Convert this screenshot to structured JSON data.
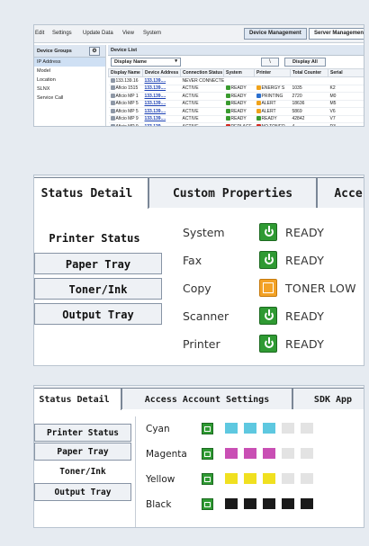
{
  "panel1": {
    "menu": [
      "Edit",
      "Settings",
      "Update Data",
      "View",
      "System"
    ],
    "toolbar_tabs": [
      "Device Management",
      "Server Management"
    ],
    "groups": {
      "title": "Device Groups",
      "items": [
        "IP Address",
        "Model",
        "Location",
        "SLNX",
        "Service Call"
      ]
    },
    "device_list": {
      "title": "Device List",
      "display_select": "Display Name",
      "search_button": "\\",
      "display_all": "Display All",
      "columns": [
        "Display Name",
        "Device Address",
        "Connection Status",
        "System",
        "Printer",
        "Total Counter",
        "Serial"
      ],
      "rows": [
        {
          "name": "133.139.16",
          "addr": "133.139....",
          "conn": "NEVER CONNECTED",
          "sys": "",
          "sys_icon": "",
          "printer": "",
          "printer_icon": "",
          "counter": "",
          "serial": ""
        },
        {
          "name": "Aficio 1515",
          "addr": "133.139....",
          "conn": "ACTIVE",
          "sys": "READY",
          "sys_icon": "g",
          "printer": "ENERGY S",
          "printer_icon": "y",
          "counter": "1035",
          "serial": "K2"
        },
        {
          "name": "Aficio MP 1",
          "addr": "133.139....",
          "conn": "ACTIVE",
          "sys": "READY",
          "sys_icon": "g",
          "printer": "PRINTING",
          "printer_icon": "b",
          "counter": "2720",
          "serial": "M0"
        },
        {
          "name": "Aficio MP 5",
          "addr": "133.139....",
          "conn": "ACTIVE",
          "sys": "READY",
          "sys_icon": "g",
          "printer": "ALERT",
          "printer_icon": "y",
          "counter": "18636",
          "serial": "M5"
        },
        {
          "name": "Aficio MP 5",
          "addr": "133.139....",
          "conn": "ACTIVE",
          "sys": "READY",
          "sys_icon": "g",
          "printer": "ALERT",
          "printer_icon": "y",
          "counter": "5869",
          "serial": "V6"
        },
        {
          "name": "Aficio MP 9",
          "addr": "133.139....",
          "conn": "ACTIVE",
          "sys": "READY",
          "sys_icon": "g",
          "printer": "READY",
          "printer_icon": "g",
          "counter": "42842",
          "serial": "V7"
        },
        {
          "name": "Aficio MP 9",
          "addr": "133.139....",
          "conn": "ACTIVE",
          "sys": "REPLACE",
          "sys_icon": "r",
          "printer": "NO TONER",
          "printer_icon": "r",
          "counter": "4",
          "serial": "D3"
        }
      ]
    }
  },
  "panel2": {
    "tabs": [
      "Status Detail",
      "Custom Properties",
      "Acce"
    ],
    "side": [
      "Printer Status",
      "Paper Tray",
      "Toner/Ink",
      "Output Tray"
    ],
    "rows": [
      {
        "label": "System",
        "value": "READY",
        "icon": "ready-icon"
      },
      {
        "label": "Fax",
        "value": "READY",
        "icon": "ready-icon"
      },
      {
        "label": "Copy",
        "value": "TONER LOW",
        "icon": "warning-icon"
      },
      {
        "label": "Scanner",
        "value": "READY",
        "icon": "ready-icon"
      },
      {
        "label": "Printer",
        "value": "READY",
        "icon": "ready-icon"
      }
    ]
  },
  "panel3": {
    "tabs": [
      "Status Detail",
      "Access Account Settings",
      "SDK App"
    ],
    "side": [
      "Printer Status",
      "Paper Tray",
      "Toner/Ink",
      "Output Tray"
    ],
    "toner": [
      {
        "label": "Cyan",
        "color": "#5ec8e0",
        "level": 3
      },
      {
        "label": "Magenta",
        "color": "#c94fb4",
        "level": 3
      },
      {
        "label": "Yellow",
        "color": "#f0e020",
        "level": 3
      },
      {
        "label": "Black",
        "color": "#1a1a1a",
        "level": 5
      }
    ],
    "level_max": 5,
    "empty_color": "#e3e3e3"
  }
}
